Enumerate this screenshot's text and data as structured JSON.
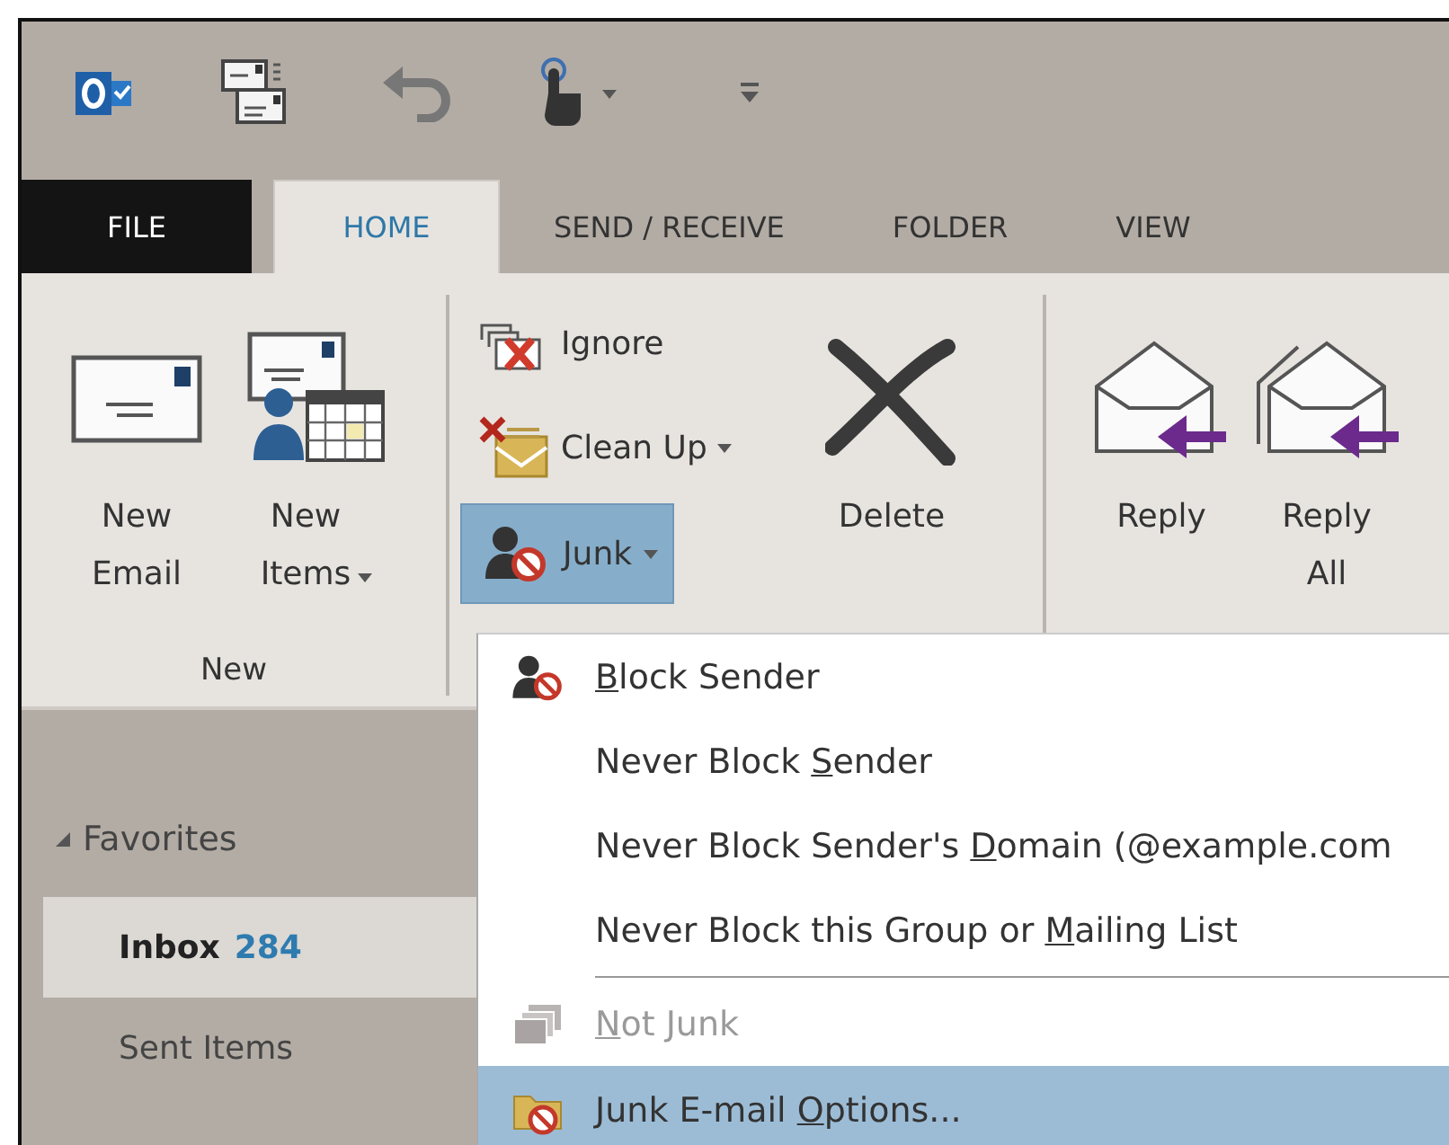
{
  "tabs": [
    {
      "label": "FILE",
      "kind": "file",
      "selected": false
    },
    {
      "label": "HOME",
      "kind": "tab",
      "selected": true
    },
    {
      "label": "SEND / RECEIVE",
      "kind": "tab",
      "selected": false
    },
    {
      "label": "FOLDER",
      "kind": "tab",
      "selected": false
    },
    {
      "label": "VIEW",
      "kind": "tab",
      "selected": false
    }
  ],
  "ribbon": {
    "groups": [
      {
        "label": "New",
        "buttons": [
          {
            "kind": "large",
            "label": "New\nEmail",
            "dropdown": false,
            "highlighted": false
          },
          {
            "kind": "large",
            "label": "New\nItems",
            "dropdown": true,
            "highlighted": false
          }
        ]
      },
      {
        "buttons": [
          {
            "kind": "small",
            "label": "Ignore",
            "dropdown": false,
            "highlighted": false
          },
          {
            "kind": "small",
            "label": "Clean Up",
            "dropdown": true,
            "highlighted": false
          },
          {
            "kind": "small",
            "label": "Junk",
            "dropdown": true,
            "highlighted": true
          },
          {
            "kind": "large",
            "label": "Delete",
            "dropdown": false,
            "highlighted": false
          }
        ]
      },
      {
        "buttons": [
          {
            "kind": "large",
            "label": "Reply",
            "dropdown": false,
            "highlighted": false
          },
          {
            "kind": "large",
            "label": "Reply\nAll",
            "dropdown": false,
            "highlighted": false
          }
        ]
      }
    ]
  },
  "sidebar": {
    "favorites": {
      "label": "Favorites",
      "expanded": true
    },
    "folders": [
      {
        "name": "Inbox",
        "count": "284",
        "selected": true
      },
      {
        "name": "Sent Items",
        "selected": false
      }
    ]
  },
  "menu": {
    "items": [
      {
        "kind": "item",
        "icon": true,
        "disabled": false,
        "highlighted": false,
        "segments": [
          {
            "text": "B",
            "underlined": true
          },
          {
            "text": "lock Sender",
            "underlined": false
          }
        ]
      },
      {
        "kind": "item",
        "icon": false,
        "disabled": false,
        "highlighted": false,
        "segments": [
          {
            "text": "Never Block ",
            "underlined": false
          },
          {
            "text": "S",
            "underlined": true
          },
          {
            "text": "ender",
            "underlined": false
          }
        ]
      },
      {
        "kind": "item",
        "icon": false,
        "disabled": false,
        "highlighted": false,
        "segments": [
          {
            "text": "Never Block Sender's ",
            "underlined": false
          },
          {
            "text": "D",
            "underlined": true
          },
          {
            "text": "omain (@example.com",
            "underlined": false
          }
        ]
      },
      {
        "kind": "item",
        "icon": false,
        "disabled": false,
        "highlighted": false,
        "segments": [
          {
            "text": "Never Block this Group or ",
            "underlined": false
          },
          {
            "text": "M",
            "underlined": true
          },
          {
            "text": "ailing List",
            "underlined": false
          }
        ]
      },
      {
        "kind": "separator"
      },
      {
        "kind": "item",
        "icon": true,
        "disabled": true,
        "highlighted": false,
        "segments": [
          {
            "text": "N",
            "underlined": true
          },
          {
            "text": "ot Junk",
            "underlined": false
          }
        ]
      },
      {
        "kind": "item",
        "icon": true,
        "disabled": false,
        "highlighted": true,
        "segments": [
          {
            "text": "Junk E-mail ",
            "underlined": false
          },
          {
            "text": "O",
            "underlined": true
          },
          {
            "text": "ptions...",
            "underlined": false
          }
        ]
      }
    ]
  }
}
